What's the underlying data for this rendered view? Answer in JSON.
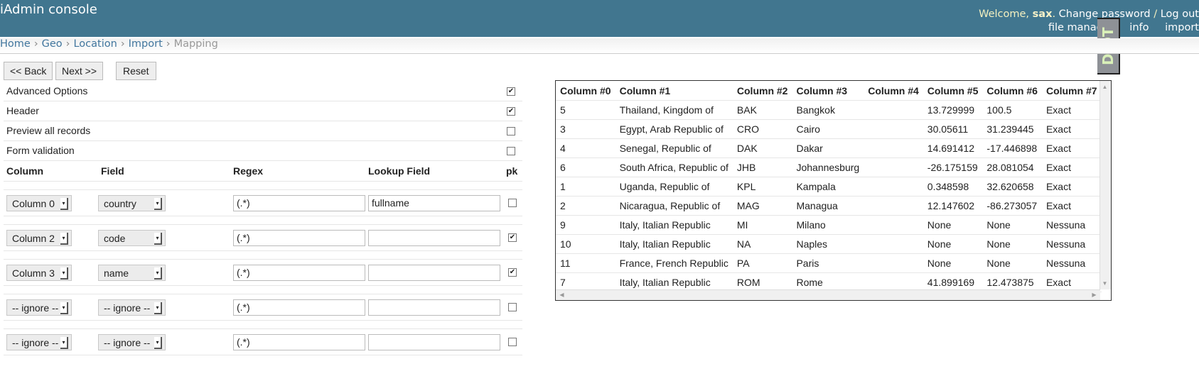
{
  "header": {
    "title": "iAdmin console",
    "welcome_prefix": "Welcome, ",
    "user": "sax",
    "welcome_suffix": ". ",
    "change_password": "Change password",
    "sep": " / ",
    "logout": "Log out",
    "links": [
      "file manager",
      "info",
      "import"
    ],
    "djdt": "DjDT"
  },
  "breadcrumb": [
    "Home",
    "Geo",
    "Location",
    "Import"
  ],
  "breadcrumb_current": "Mapping",
  "buttons": {
    "back": "<< Back",
    "next": "Next >>",
    "reset": "Reset"
  },
  "options": [
    {
      "label": "Advanced Options",
      "checked": true
    },
    {
      "label": "Header",
      "checked": true
    },
    {
      "label": "Preview all records",
      "checked": false
    },
    {
      "label": "Form validation",
      "checked": false
    }
  ],
  "mapping_headers": {
    "column": "Column",
    "field": "Field",
    "regex": "Regex",
    "lookup": "Lookup Field",
    "pk": "pk"
  },
  "mappings": [
    {
      "column": "Column 0",
      "field": "country",
      "regex": "(.*)",
      "lookup": "fullname",
      "pk": false
    },
    {
      "column": "Column 2",
      "field": "code",
      "regex": "(.*)",
      "lookup": "",
      "pk": true
    },
    {
      "column": "Column 3",
      "field": "name",
      "regex": "(.*)",
      "lookup": "",
      "pk": true
    },
    {
      "column": "-- ignore --",
      "field": "-- ignore --",
      "regex": "(.*)",
      "lookup": "",
      "pk": false
    },
    {
      "column": "-- ignore --",
      "field": "-- ignore --",
      "regex": "(.*)",
      "lookup": "",
      "pk": false
    }
  ],
  "preview": {
    "columns": [
      "Column #0",
      "Column #1",
      "Column #2",
      "Column #3",
      "Column #4",
      "Column #5",
      "Column #6",
      "Column #7"
    ],
    "rows": [
      [
        "5",
        "Thailand, Kingdom of",
        "BAK",
        "Bangkok",
        "",
        "13.729999",
        "100.5",
        "Exact"
      ],
      [
        "3",
        "Egypt, Arab Republic of",
        "CRO",
        "Cairo",
        "",
        "30.05611",
        "31.239445",
        "Exact"
      ],
      [
        "4",
        "Senegal, Republic of",
        "DAK",
        "Dakar",
        "",
        "14.691412",
        "-17.446898",
        "Exact"
      ],
      [
        "6",
        "South Africa, Republic of",
        "JHB",
        "Johannesburg",
        "",
        "-26.175159",
        "28.081054",
        "Exact"
      ],
      [
        "1",
        "Uganda, Republic of",
        "KPL",
        "Kampala",
        "",
        "0.348598",
        "32.620658",
        "Exact"
      ],
      [
        "2",
        "Nicaragua, Republic of",
        "MAG",
        "Managua",
        "",
        "12.147602",
        "-86.273057",
        "Exact"
      ],
      [
        "9",
        "Italy, Italian Republic",
        "MI",
        "Milano",
        "",
        "None",
        "None",
        "Nessuna"
      ],
      [
        "10",
        "Italy, Italian Republic",
        "NA",
        "Naples",
        "",
        "None",
        "None",
        "Nessuna"
      ],
      [
        "11",
        "France, French Republic",
        "PA",
        "Paris",
        "",
        "None",
        "None",
        "Nessuna"
      ],
      [
        "7",
        "Italy, Italian Republic",
        "ROM",
        "Rome",
        "",
        "41.899169",
        "12.473875",
        "Exact"
      ]
    ]
  }
}
